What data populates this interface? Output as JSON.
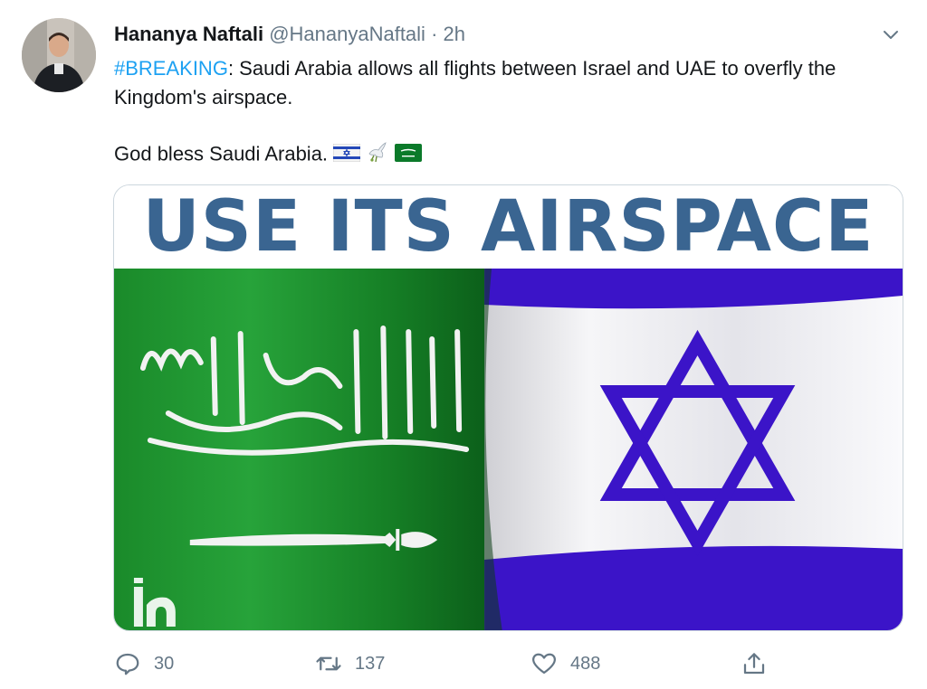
{
  "tweet": {
    "author": {
      "name": "Hananya Naftali",
      "handle": "@HananyaNaftali",
      "time": "2h",
      "separator": "·"
    },
    "text": {
      "hashtag": "#BREAKING",
      "line1_rest": ": Saudi Arabia allows all flights between Israel and UAE to overfly the Kingdom's airspace.",
      "line2": "God bless Saudi Arabia."
    },
    "emojis": [
      "israel-flag",
      "dove-of-peace",
      "saudi-flag"
    ],
    "media": {
      "headline": "USE ITS AIRSPACE",
      "watermark_logo": "in",
      "colors": {
        "headline": "#3a6591",
        "saudi_green": "#1e8a2c",
        "israel_blue": "#3b14c8",
        "israel_white": "#f2f2f4"
      }
    },
    "actions": {
      "replies": "30",
      "retweets": "137",
      "likes": "488"
    }
  },
  "colors": {
    "text": "#14171a",
    "secondary": "#657786",
    "link": "#1da1f2",
    "border": "#ccd6dd"
  }
}
